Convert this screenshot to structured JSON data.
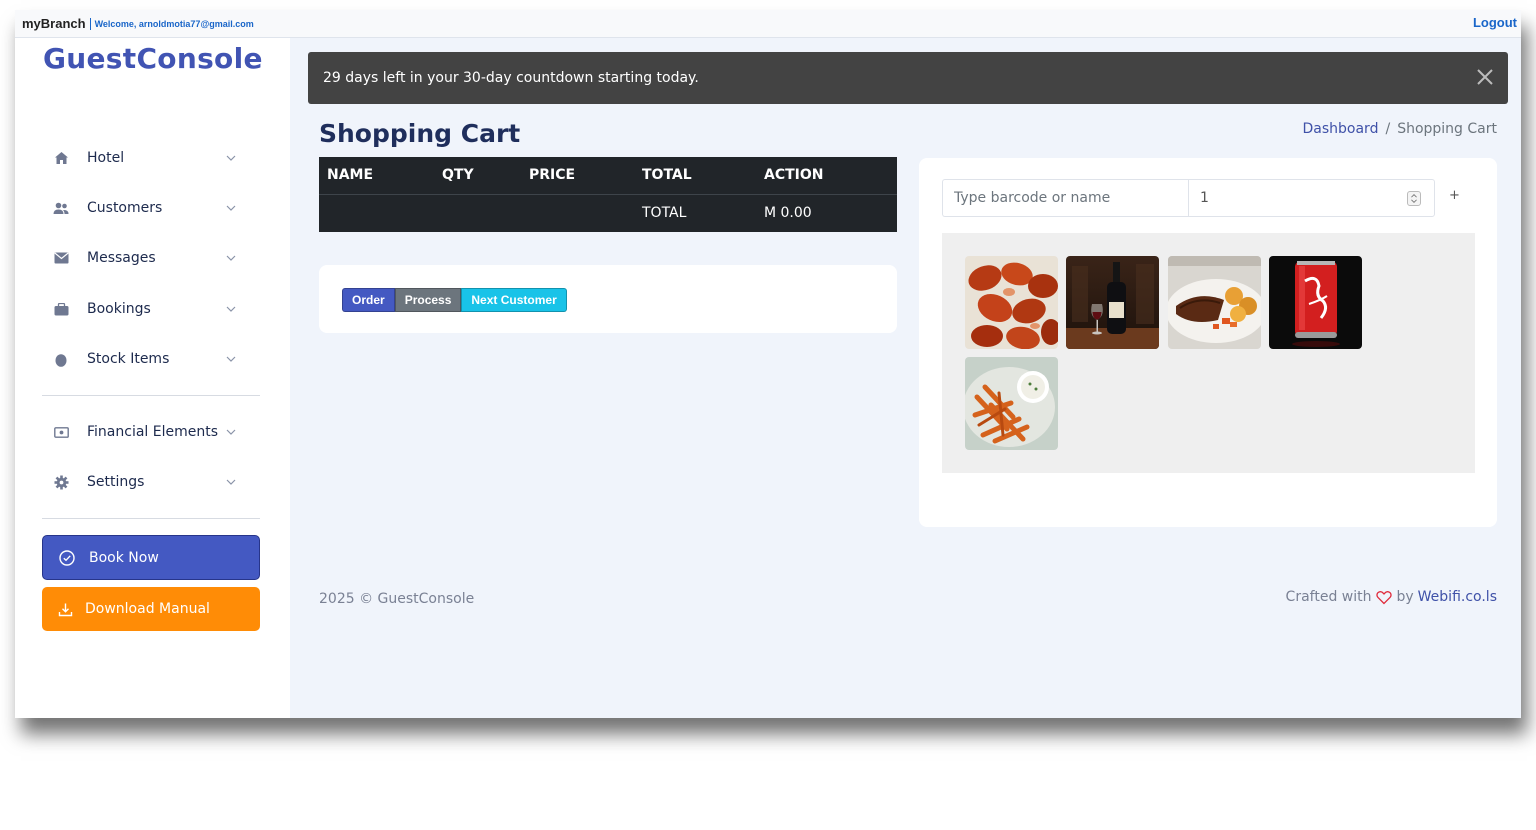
{
  "topbar": {
    "brand": "myBranch",
    "welcome": "Welcome, arnoldmotia77@gmail.com",
    "logout": "Logout"
  },
  "sidebar": {
    "logo": "GuestConsole",
    "items": [
      {
        "label": "Hotel",
        "icon": "home-icon"
      },
      {
        "label": "Customers",
        "icon": "users-icon"
      },
      {
        "label": "Messages",
        "icon": "envelope-icon"
      },
      {
        "label": "Bookings",
        "icon": "briefcase-icon"
      },
      {
        "label": "Stock Items",
        "icon": "egg-icon"
      },
      {
        "label": "Financial Elements",
        "icon": "money-icon"
      },
      {
        "label": "Settings",
        "icon": "gear-icon"
      }
    ],
    "book_now": "Book Now",
    "download_manual": "Download Manual"
  },
  "alert": {
    "message": "29 days left in your 30-day countdown starting today."
  },
  "page": {
    "title": "Shopping Cart",
    "breadcrumb": [
      "Dashboard",
      "/",
      "Shopping Cart"
    ]
  },
  "cart": {
    "headers": [
      "NAME",
      "QTY",
      "PRICE",
      "TOTAL",
      "ACTION"
    ],
    "total_label": "TOTAL",
    "total_value": "M 0.00"
  },
  "actions": {
    "order": "Order",
    "process": "Process",
    "next_customer": "Next Customer"
  },
  "products": {
    "search_placeholder": "Type barcode or name",
    "quantity": "1",
    "add": "+",
    "items": [
      {
        "icon": "chicken-wings-image"
      },
      {
        "icon": "wine-bottle-image"
      },
      {
        "icon": "grilled-meat-plate-image"
      },
      {
        "icon": "coca-cola-can-image"
      },
      {
        "icon": "sweet-potato-fries-image"
      }
    ]
  },
  "footer": {
    "copyright": "2025 © GuestConsole",
    "crafted": "Crafted with",
    "by": "by",
    "company": "Webifi.co.ls"
  },
  "colors": {
    "primary": "#4459c2",
    "orange": "#ff8c06",
    "info": "#19c3e8",
    "secondary": "#6c757d",
    "dark": "#212529",
    "heart": "#e02b3c"
  }
}
